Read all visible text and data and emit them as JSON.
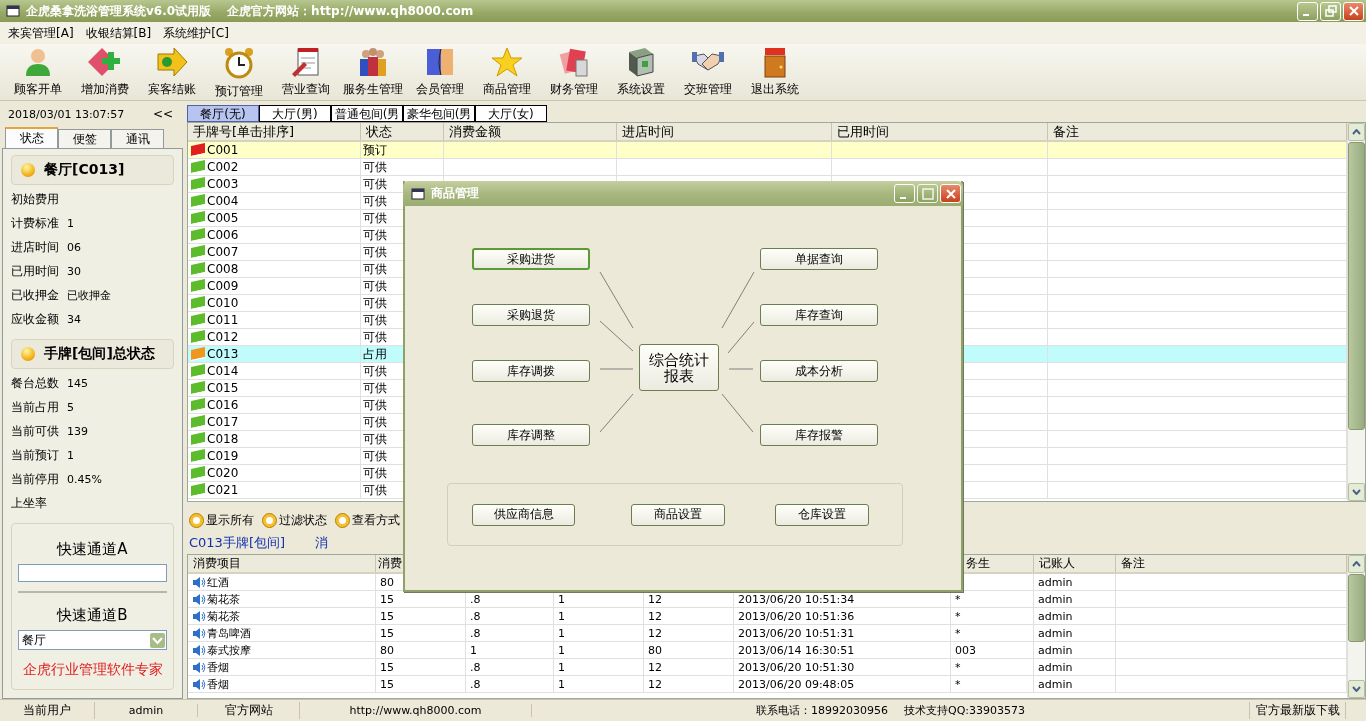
{
  "window": {
    "title": "企虎桑拿洗浴管理系统v6.0试用版",
    "website": "企虎官方网站：http://www.qh8000.com"
  },
  "menu": [
    {
      "label": "来宾管理[A]"
    },
    {
      "label": "收银结算[B]"
    },
    {
      "label": "系统维护[C]"
    }
  ],
  "toolbar": [
    {
      "label": "顾客开单"
    },
    {
      "label": "增加消费"
    },
    {
      "label": "宾客结账"
    },
    {
      "label": "预订管理"
    },
    {
      "label": "营业查询"
    },
    {
      "label": "服务生管理"
    },
    {
      "label": "会员管理"
    },
    {
      "label": "商品管理"
    },
    {
      "label": "财务管理"
    },
    {
      "label": "系统设置"
    },
    {
      "label": "交班管理"
    },
    {
      "label": "退出系统"
    }
  ],
  "sidebar": {
    "datetime": "2018/03/01 13:07:57",
    "collapse": "<<",
    "tabs": [
      {
        "label": "状态",
        "selected": true
      },
      {
        "label": "便签",
        "selected": false
      },
      {
        "label": "通讯",
        "selected": false
      }
    ],
    "sections": [
      {
        "title": "餐厅[C013]",
        "fields": [
          {
            "label": "初始费用"
          },
          {
            "label": "计费标准",
            "value": "1"
          },
          {
            "label": "进店时间",
            "value": "06"
          },
          {
            "label": "已用时间",
            "value": "30"
          },
          {
            "label": "已收押金",
            "value": "已收押金"
          },
          {
            "label": "应收金额",
            "value": "34"
          }
        ]
      },
      {
        "title": "手牌[包间]总状态",
        "fields": [
          {
            "label": "餐台总数",
            "value": "145"
          },
          {
            "label": "当前占用",
            "value": "5"
          },
          {
            "label": "当前可供",
            "value": "139"
          },
          {
            "label": "当前预订",
            "value": "1"
          },
          {
            "label": "当前停用",
            "value": "0.45%"
          },
          {
            "label": "上坐率"
          }
        ]
      }
    ],
    "quick_a": {
      "label": "快速通道A"
    },
    "quick_b": {
      "label": "快速通道B",
      "value": "餐厅"
    },
    "slogan": "企虎行业管理软件专家"
  },
  "area_tabs": [
    {
      "label": "餐厅(无)",
      "selected": true
    },
    {
      "label": "大厅(男)",
      "selected": false
    },
    {
      "label": "普通包间(男",
      "selected": false
    },
    {
      "label": "豪华包间(男",
      "selected": false
    },
    {
      "label": "大厅(女)",
      "selected": false
    }
  ],
  "handle_table": {
    "columns": [
      "手牌号[单击排序]",
      "状态",
      "消费金额",
      "进店时间",
      "已用时间",
      "备注"
    ],
    "rows": [
      {
        "handle": "C001",
        "status": "预订",
        "kind": "reserved",
        "selected": false
      },
      {
        "handle": "C002",
        "status": "可供",
        "kind": "available",
        "selected": false
      },
      {
        "handle": "C003",
        "status": "可供",
        "kind": "available",
        "selected": false
      },
      {
        "handle": "C004",
        "status": "可供",
        "kind": "available",
        "selected": false
      },
      {
        "handle": "C005",
        "status": "可供",
        "kind": "available",
        "selected": false
      },
      {
        "handle": "C006",
        "status": "可供",
        "kind": "available",
        "selected": false
      },
      {
        "handle": "C007",
        "status": "可供",
        "kind": "available",
        "selected": false
      },
      {
        "handle": "C008",
        "status": "可供",
        "kind": "available",
        "selected": false
      },
      {
        "handle": "C009",
        "status": "可供",
        "kind": "available",
        "selected": false
      },
      {
        "handle": "C010",
        "status": "可供",
        "kind": "available",
        "selected": false
      },
      {
        "handle": "C011",
        "status": "可供",
        "kind": "available",
        "selected": false
      },
      {
        "handle": "C012",
        "status": "可供",
        "kind": "available",
        "selected": false
      },
      {
        "handle": "C013",
        "status": "占用",
        "kind": "occupied",
        "selected": true
      },
      {
        "handle": "C014",
        "status": "可供",
        "kind": "available",
        "selected": false
      },
      {
        "handle": "C015",
        "status": "可供",
        "kind": "available",
        "selected": false
      },
      {
        "handle": "C016",
        "status": "可供",
        "kind": "available",
        "selected": false
      },
      {
        "handle": "C017",
        "status": "可供",
        "kind": "available",
        "selected": false
      },
      {
        "handle": "C018",
        "status": "可供",
        "kind": "available",
        "selected": false
      },
      {
        "handle": "C019",
        "status": "可供",
        "kind": "available",
        "selected": false
      },
      {
        "handle": "C020",
        "status": "可供",
        "kind": "available",
        "selected": false
      },
      {
        "handle": "C021",
        "status": "可供",
        "kind": "available",
        "selected": false
      }
    ]
  },
  "actions": [
    {
      "label": "显示所有"
    },
    {
      "label": "过滤状态"
    },
    {
      "label": "查看方式"
    }
  ],
  "detail_caption": {
    "title": "C013手牌[包间]",
    "text": "消"
  },
  "detail_table": {
    "columns": {
      "item": "消费项目",
      "column_2": "消费",
      "column_7": "务生",
      "recorder": "记账人",
      "note": "备注"
    },
    "rows": [
      {
        "item": "红酒",
        "column_2": "80",
        "recorder": "admin"
      },
      {
        "item": "菊花茶",
        "column_2": "15",
        "column_3": ".8",
        "column_4": "1",
        "column_5": "12",
        "column_6": "2013/06/20 10:51:34",
        "column_7": "*",
        "recorder": "admin"
      },
      {
        "item": "菊花茶",
        "column_2": "15",
        "column_3": ".8",
        "column_4": "1",
        "column_5": "12",
        "column_6": "2013/06/20 10:51:36",
        "column_7": "*",
        "recorder": "admin"
      },
      {
        "item": "青岛啤酒",
        "column_2": "15",
        "column_3": ".8",
        "column_4": "1",
        "column_5": "12",
        "column_6": "2013/06/20 10:51:31",
        "column_7": "*",
        "recorder": "admin"
      },
      {
        "item": "泰式按摩",
        "column_2": "80",
        "column_3": "1",
        "column_4": "1",
        "column_5": "80",
        "column_6": "2013/06/14 16:30:51",
        "column_7": "003",
        "recorder": "admin"
      },
      {
        "item": "香烟",
        "column_2": "15",
        "column_3": ".8",
        "column_4": "1",
        "column_5": "12",
        "column_6": "2013/06/20 10:51:30",
        "column_7": "*",
        "recorder": "admin"
      },
      {
        "item": "香烟",
        "column_2": "15",
        "column_3": ".8",
        "column_4": "1",
        "column_5": "12",
        "column_6": "2013/06/20 09:48:05",
        "column_7": "*",
        "recorder": "admin"
      }
    ]
  },
  "dialog": {
    "title": "商品管理",
    "left_buttons": [
      {
        "label": "采购进货",
        "selected": true
      },
      {
        "label": "采购退货",
        "selected": false
      },
      {
        "label": "库存调拨",
        "selected": false
      },
      {
        "label": "库存调整",
        "selected": false
      }
    ],
    "center": "综合统计报表",
    "right_buttons": [
      {
        "label": "单据查询",
        "selected": false
      },
      {
        "label": "库存查询",
        "selected": false
      },
      {
        "label": "成本分析",
        "selected": false
      },
      {
        "label": "库存报警",
        "selected": false
      }
    ],
    "group_buttons": [
      {
        "label": "供应商信息"
      },
      {
        "label": "商品设置"
      },
      {
        "label": "仓库设置"
      }
    ]
  },
  "status_bar": {
    "left": [
      "当前用户",
      "admin",
      "官方网站",
      "http://www.qh8000.com"
    ],
    "right": [
      "联系电话：18992030956",
      "技术支持QQ:33903573"
    ],
    "end": "官方最新版下载"
  }
}
